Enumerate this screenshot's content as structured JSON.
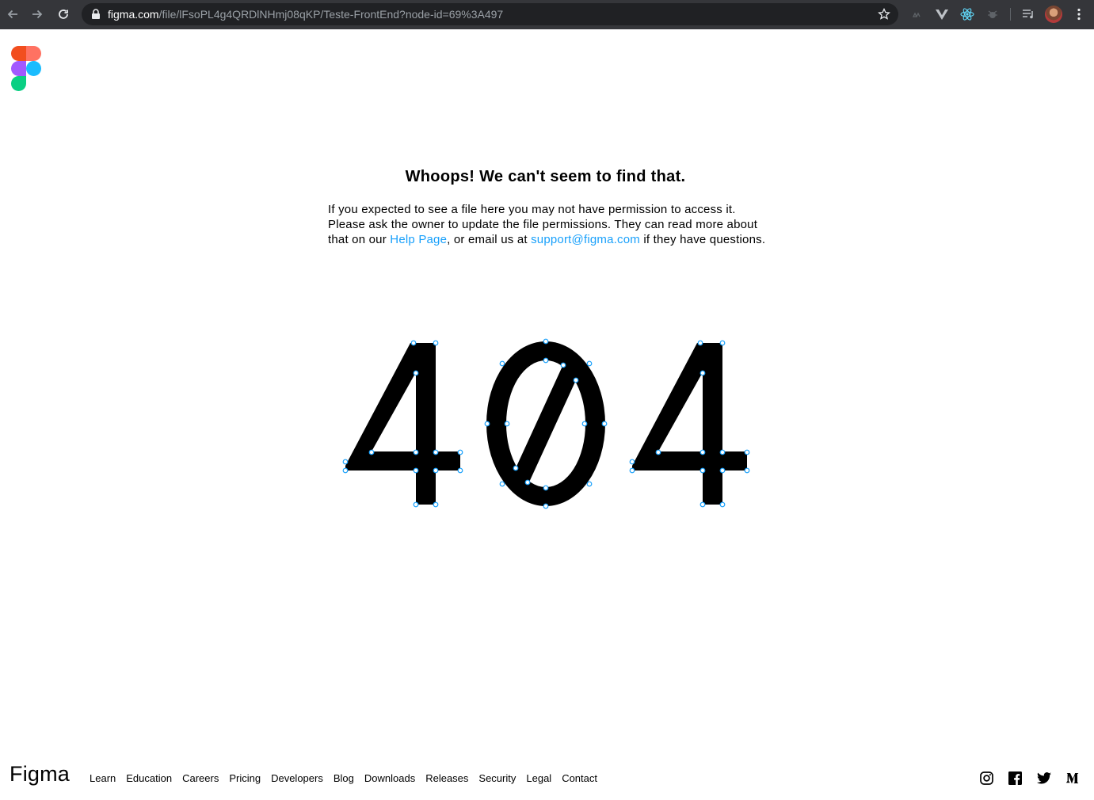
{
  "browser": {
    "url_host": "figma.com",
    "url_path": "/file/lFsoPL4g4QRDlNHmj08qKP/Teste-FrontEnd?node-id=69%3A497",
    "back_icon": "arrow-left-icon",
    "forward_icon": "arrow-right-icon",
    "reload_icon": "reload-icon",
    "lock_icon": "lock-icon",
    "bookmark_icon": "star-icon",
    "menu_icon": "kebab-menu-icon"
  },
  "brand": {
    "logo_icon": "figma-logo-icon",
    "footer_logo": "Figma",
    "colors": {
      "red": "#f24e1e",
      "orange": "#ff7262",
      "purple": "#a259ff",
      "blue": "#1abcfe",
      "green": "#0acf83",
      "link": "#18a0fb"
    }
  },
  "error": {
    "headline": "Whoops! We can't seem to find that.",
    "message_part1": "If you expected to see a file here you may not have permission to access it. Please ask the owner to update the file permissions. They can read more about that on our ",
    "help_link": "Help Page",
    "message_part2": ", or email us at ",
    "email_link": "support@figma.com",
    "message_part3": " if they have questions.",
    "code": "404"
  },
  "footer": {
    "links": [
      "Learn",
      "Education",
      "Careers",
      "Pricing",
      "Developers",
      "Blog",
      "Downloads",
      "Releases",
      "Security",
      "Legal",
      "Contact"
    ],
    "social_icons": [
      "instagram-icon",
      "facebook-icon",
      "twitter-icon",
      "medium-icon"
    ]
  }
}
